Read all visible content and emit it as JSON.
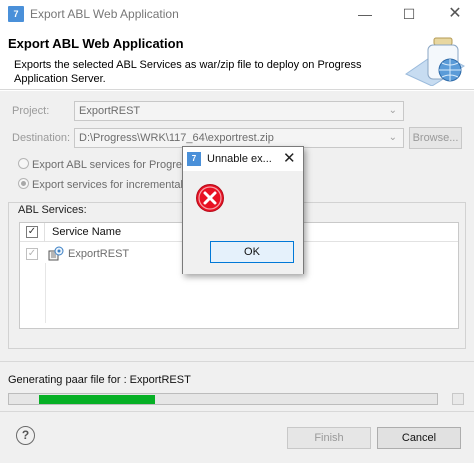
{
  "window": {
    "title": "Export ABL Web Application",
    "app_icon": "7",
    "minimize_icon": "minimize-icon",
    "maximize_icon": "maximize-icon",
    "close_icon": "close-icon"
  },
  "banner": {
    "heading": "Export ABL Web Application",
    "description": "Exports the selected ABL Services as war/zip file to deploy on Progress Application Server."
  },
  "form": {
    "project_label": "Project:",
    "project_value": "ExportREST",
    "destination_label": "Destination:",
    "destination_value": "D:\\Progress\\WRK\\117_64\\exportrest.zip",
    "browse_label": "Browse...",
    "radio_1": "Export ABL services for Progress",
    "radio_2": "Export services for incremental",
    "radio_2_selected": true
  },
  "services": {
    "group_label": "ABL Services:",
    "column_header": "Service Name",
    "header_checked": true,
    "items": [
      {
        "label": "ExportREST",
        "checked": true
      }
    ]
  },
  "progress": {
    "status_text": "Generating paar file for : ExportREST",
    "fraction": 0.27,
    "color": "#06b025"
  },
  "footer": {
    "help_glyph": "?",
    "finish_label": "Finish",
    "cancel_label": "Cancel"
  },
  "dialog": {
    "title": "Unnable ex...",
    "app_icon": "7",
    "icon": "error-icon",
    "ok_label": "OK",
    "error_color": "#e81123"
  }
}
